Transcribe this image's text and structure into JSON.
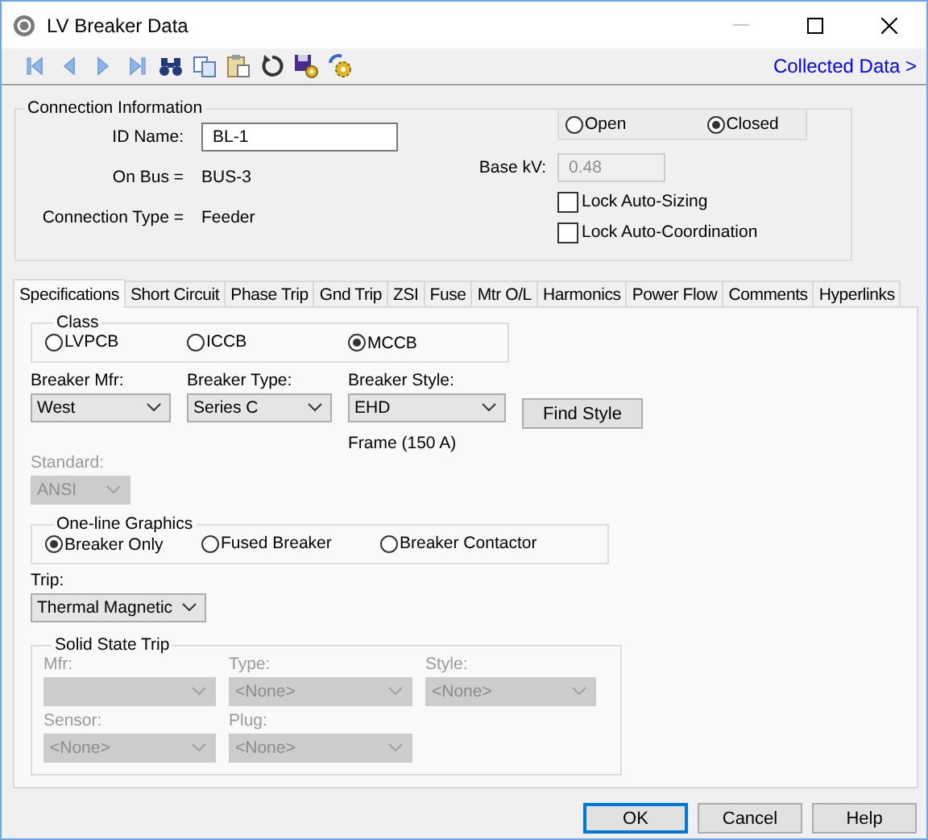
{
  "window": {
    "title": "LV Breaker Data"
  },
  "toolbar": {
    "link": "Collected Data >"
  },
  "connection": {
    "title": "Connection Information",
    "id_name": {
      "label": "ID Name:",
      "value": "BL-1"
    },
    "on_bus": {
      "label": "On Bus =",
      "value": "BUS-3"
    },
    "connection_type": {
      "label": "Connection Type =",
      "value": "Feeder"
    },
    "status_options": [
      {
        "label": "Open",
        "selected": false
      },
      {
        "label": "Closed",
        "selected": true
      }
    ],
    "base_kv": {
      "label": "Base kV:",
      "value": "0.48",
      "disabled": true
    },
    "checkboxes": [
      {
        "label": "Lock Auto-Sizing",
        "checked": false
      },
      {
        "label": "Lock Auto-Coordination",
        "checked": false
      }
    ]
  },
  "tabs": [
    {
      "label": "Specifications",
      "selected": true
    },
    {
      "label": "Short Circuit",
      "selected": false
    },
    {
      "label": "Phase Trip",
      "selected": false
    },
    {
      "label": "Gnd Trip",
      "selected": false
    },
    {
      "label": "ZSI",
      "selected": false
    },
    {
      "label": "Fuse",
      "selected": false
    },
    {
      "label": "Mtr O/L",
      "selected": false
    },
    {
      "label": "Harmonics",
      "selected": false
    },
    {
      "label": "Power Flow",
      "selected": false
    },
    {
      "label": "Comments",
      "selected": false
    },
    {
      "label": "Hyperlinks",
      "selected": false
    }
  ],
  "specifications": {
    "class_group": {
      "title": "Class",
      "options": [
        {
          "label": "LVPCB",
          "selected": false
        },
        {
          "label": "ICCB",
          "selected": false
        },
        {
          "label": "MCCB",
          "selected": true
        }
      ]
    },
    "breaker_fields": [
      {
        "label": "Breaker Mfr:",
        "value": "West",
        "disabled": false
      },
      {
        "label": "Breaker Type:",
        "value": "Series C",
        "disabled": false
      },
      {
        "label": "Breaker Style:",
        "value": "EHD",
        "disabled": false
      }
    ],
    "find_style_button": "Find Style",
    "frame_note": "Frame (150 A)",
    "standard": {
      "label": "Standard:",
      "value": "ANSI",
      "disabled": true
    },
    "one_line_graphics": {
      "title": "One-line Graphics",
      "options": [
        {
          "label": "Breaker Only",
          "selected": true
        },
        {
          "label": "Fused Breaker",
          "selected": false
        },
        {
          "label": "Breaker Contactor",
          "selected": false
        }
      ]
    },
    "trip": {
      "label": "Trip:",
      "value": "Thermal Magnetic",
      "disabled": false
    },
    "solid_state_trip": {
      "title": "Solid State Trip",
      "fields": [
        {
          "label": "Mfr:",
          "disabled": true
        },
        {
          "label": "Type:",
          "value": "<None>",
          "disabled": true
        },
        {
          "label": "Style:",
          "value": "<None>",
          "disabled": true
        },
        {
          "label": "Sensor:",
          "value": "<None>",
          "disabled": true
        },
        {
          "label": "Plug:",
          "value": "<None>",
          "disabled": true
        }
      ]
    }
  },
  "buttons": [
    {
      "label": "OK",
      "default": true
    },
    {
      "label": "Cancel",
      "default": false
    },
    {
      "label": "Help",
      "default": false
    }
  ]
}
